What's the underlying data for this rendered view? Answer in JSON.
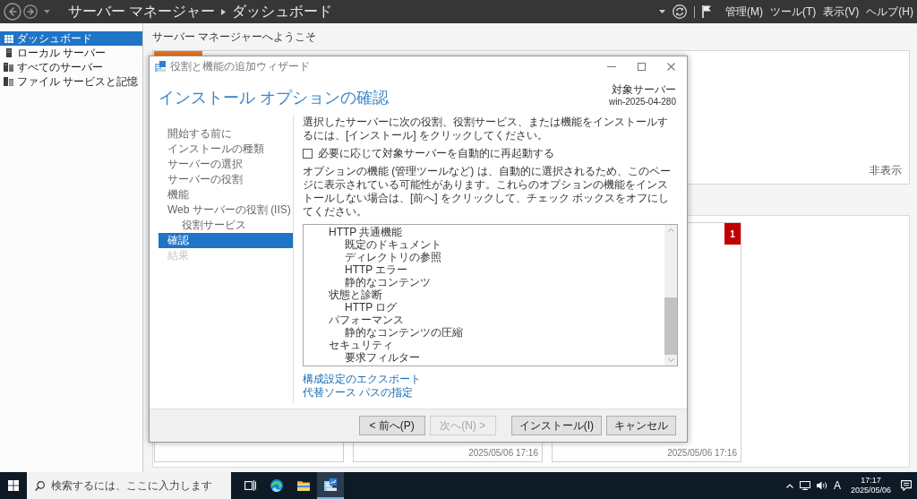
{
  "header_bar": {
    "breadcrumb": [
      "サーバー マネージャー",
      "ダッシュボード"
    ],
    "menus": [
      "管理(M)",
      "ツール(T)",
      "表示(V)",
      "ヘルプ(H)"
    ]
  },
  "sidebar": {
    "items": [
      {
        "label": "ダッシュボード",
        "kind": "grid",
        "selected": true
      },
      {
        "label": "ローカル サーバー",
        "kind": "server",
        "selected": false
      },
      {
        "label": "すべてのサーバー",
        "kind": "servers",
        "selected": false
      },
      {
        "label": "ファイル サービスと記憶",
        "kind": "storage",
        "selected": false
      }
    ]
  },
  "main": {
    "heading": "サーバー マネージャーへようこそ",
    "welcome_panel": {
      "hide_link": "非表示"
    },
    "tiles": [
      {
        "kind": "plain"
      },
      {
        "kind": "plain",
        "timestamp": "2025/05/06 17:16"
      },
      {
        "kind": "alert",
        "count": "1",
        "timestamp": "2025/05/06 17:16"
      }
    ]
  },
  "dialog": {
    "title": "役割と機能の追加ウィザード",
    "heading": "インストール オプションの確認",
    "target_label": "対象サーバー",
    "target_server": "win-2025-04-280",
    "steps": [
      {
        "label": "開始する前に",
        "selected": false,
        "disabled": false
      },
      {
        "label": "インストールの種類",
        "selected": false,
        "disabled": false
      },
      {
        "label": "サーバーの選択",
        "selected": false,
        "disabled": false
      },
      {
        "label": "サーバーの役割",
        "selected": false,
        "disabled": false
      },
      {
        "label": "機能",
        "selected": false,
        "disabled": false
      },
      {
        "label": "Web サーバーの役割 (IIS)",
        "selected": false,
        "disabled": false,
        "children": [
          {
            "label": "役割サービス",
            "selected": false,
            "disabled": false
          }
        ]
      },
      {
        "label": "確認",
        "selected": true,
        "disabled": false
      },
      {
        "label": "結果",
        "selected": false,
        "disabled": true
      }
    ],
    "instruction": "選択したサーバーに次の役割、役割サービス、または機能をインストールするには、[インストール] をクリックしてください。",
    "restart_checkbox": {
      "label": "必要に応じて対象サーバーを自動的に再起動する",
      "checked": false
    },
    "note": "オプションの機能 (管理ツールなど) は、自動的に選択されるため、このページに表示されている可能性があります。これらのオプションの機能をインストールしない場合は、[前へ] をクリックして、チェック ボックスをオフにしてください。",
    "features": [
      {
        "label": "HTTP 共通機能",
        "children": [
          {
            "label": "既定のドキュメント"
          },
          {
            "label": "ディレクトリの参照"
          },
          {
            "label": "HTTP エラー"
          },
          {
            "label": "静的なコンテンツ"
          }
        ]
      },
      {
        "label": "状態と診断",
        "children": [
          {
            "label": "HTTP ログ"
          }
        ]
      },
      {
        "label": "パフォーマンス",
        "children": [
          {
            "label": "静的なコンテンツの圧縮"
          }
        ]
      },
      {
        "label": "セキュリティ",
        "children": [
          {
            "label": "要求フィルター"
          }
        ]
      }
    ],
    "links": [
      "構成設定のエクスポート",
      "代替ソース パスの指定"
    ],
    "buttons": [
      {
        "label": "< 前へ(P)",
        "disabled": false
      },
      {
        "label": "次へ(N) >",
        "disabled": true
      },
      {
        "label": "インストール(I)",
        "disabled": false
      },
      {
        "label": "キャンセル",
        "disabled": false
      }
    ]
  },
  "taskbar": {
    "search": {
      "placeholder": "検索するには、ここに入力します"
    },
    "apps": [
      {
        "kind": "taskview",
        "selected": false
      },
      {
        "kind": "browser",
        "selected": false
      },
      {
        "kind": "folder",
        "selected": false
      },
      {
        "kind": "server",
        "selected": true
      }
    ],
    "ime": "A",
    "time": "17:17",
    "date": "2025/05/06"
  }
}
